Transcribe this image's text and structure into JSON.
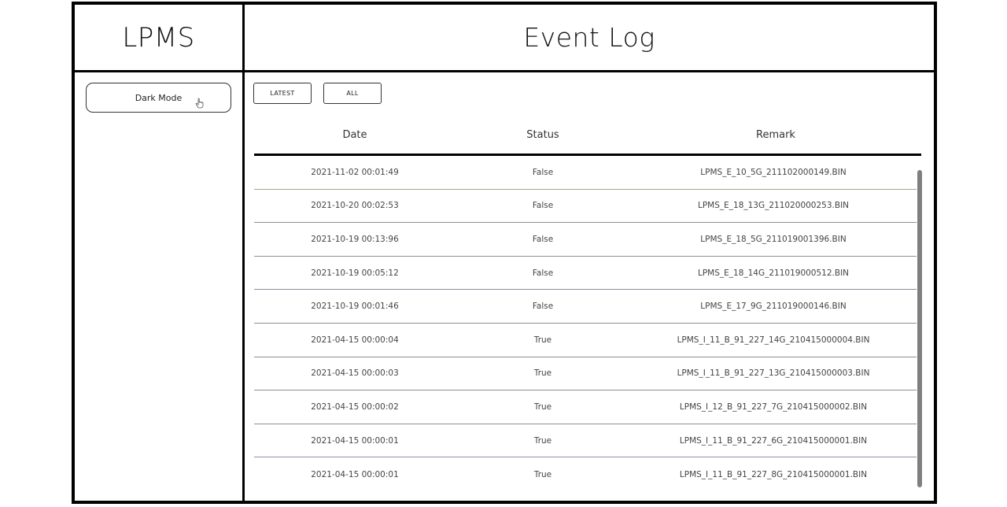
{
  "sidebar": {
    "brand": "LPMS",
    "dark_mode_label": "Dark Mode"
  },
  "header": {
    "title": "Event Log"
  },
  "filters": {
    "latest_label": "LATEST",
    "all_label": "ALL"
  },
  "table": {
    "columns": [
      "Date",
      "Status",
      "Remark"
    ],
    "rows": [
      {
        "date": "2021-11-02 00:01:49",
        "status": "False",
        "remark": "LPMS_E_10_5G_211102000149.BIN"
      },
      {
        "date": "2021-10-20 00:02:53",
        "status": "False",
        "remark": "LPMS_E_18_13G_211020000253.BIN"
      },
      {
        "date": "2021-10-19 00:13:96",
        "status": "False",
        "remark": "LPMS_E_18_5G_211019001396.BIN"
      },
      {
        "date": "2021-10-19 00:05:12",
        "status": "False",
        "remark": "LPMS_E_18_14G_211019000512.BIN"
      },
      {
        "date": "2021-10-19 00:01:46",
        "status": "False",
        "remark": "LPMS_E_17_9G_211019000146.BIN"
      },
      {
        "date": "2021-04-15 00:00:04",
        "status": "True",
        "remark": "LPMS_I_11_B_91_227_14G_210415000004.BIN"
      },
      {
        "date": "2021-04-15 00:00:03",
        "status": "True",
        "remark": "LPMS_I_11_B_91_227_13G_210415000003.BIN"
      },
      {
        "date": "2021-04-15 00:00:02",
        "status": "True",
        "remark": "LPMS_I_12_B_91_227_7G_210415000002.BIN"
      },
      {
        "date": "2021-04-15 00:00:01",
        "status": "True",
        "remark": "LPMS_I_11_B_91_227_6G_210415000001.BIN"
      },
      {
        "date": "2021-04-15 00:00:01",
        "status": "True",
        "remark": "LPMS_I_11_B_91_227_8G_210415000001.BIN"
      }
    ]
  },
  "icons": {
    "cursor": "pointer-hand-icon"
  }
}
